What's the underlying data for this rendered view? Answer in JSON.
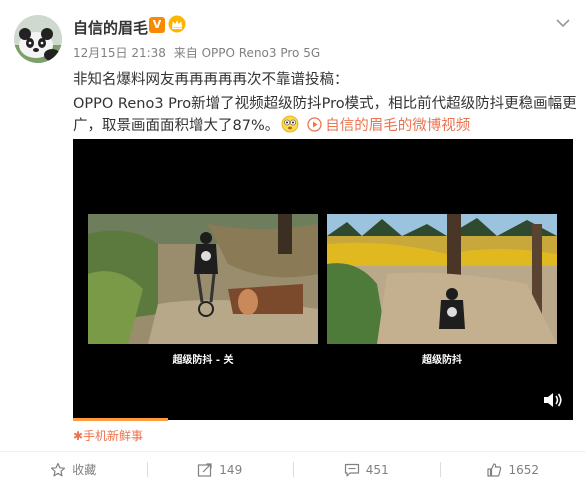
{
  "user": {
    "name": "自信的眉毛",
    "verified_badge": "V"
  },
  "meta": {
    "timestamp": "12月15日 21:38",
    "source": "来自 OPPO Reno3 Pro 5G"
  },
  "post": {
    "line1": "非知名爆料网友再再再再再次不靠谱投稿：",
    "line2": "OPPO Reno3 Pro新增了视频超级防抖Pro模式，相比前代超级防抖更稳画幅更",
    "line3": "广，取景画面面积增大了87%。",
    "video_link": "自信的眉毛的微博视频"
  },
  "video": {
    "caption_left": "超级防抖 - 关",
    "caption_right": "超级防抖",
    "progress_fraction": 0.19
  },
  "video_source": "✱手机新鲜事",
  "actions": {
    "favorite_label": "收藏",
    "repost_count": "149",
    "comment_count": "451",
    "like_count": "1652"
  },
  "colors": {
    "accent": "#eb7350",
    "verified": "#f78a00",
    "progress": "#ff9a3d"
  },
  "icons": [
    "crown-icon",
    "chevron-down-icon",
    "emoji-face-icon",
    "video-play-icon",
    "volume-icon",
    "star-icon",
    "repost-icon",
    "comment-icon",
    "like-icon"
  ]
}
